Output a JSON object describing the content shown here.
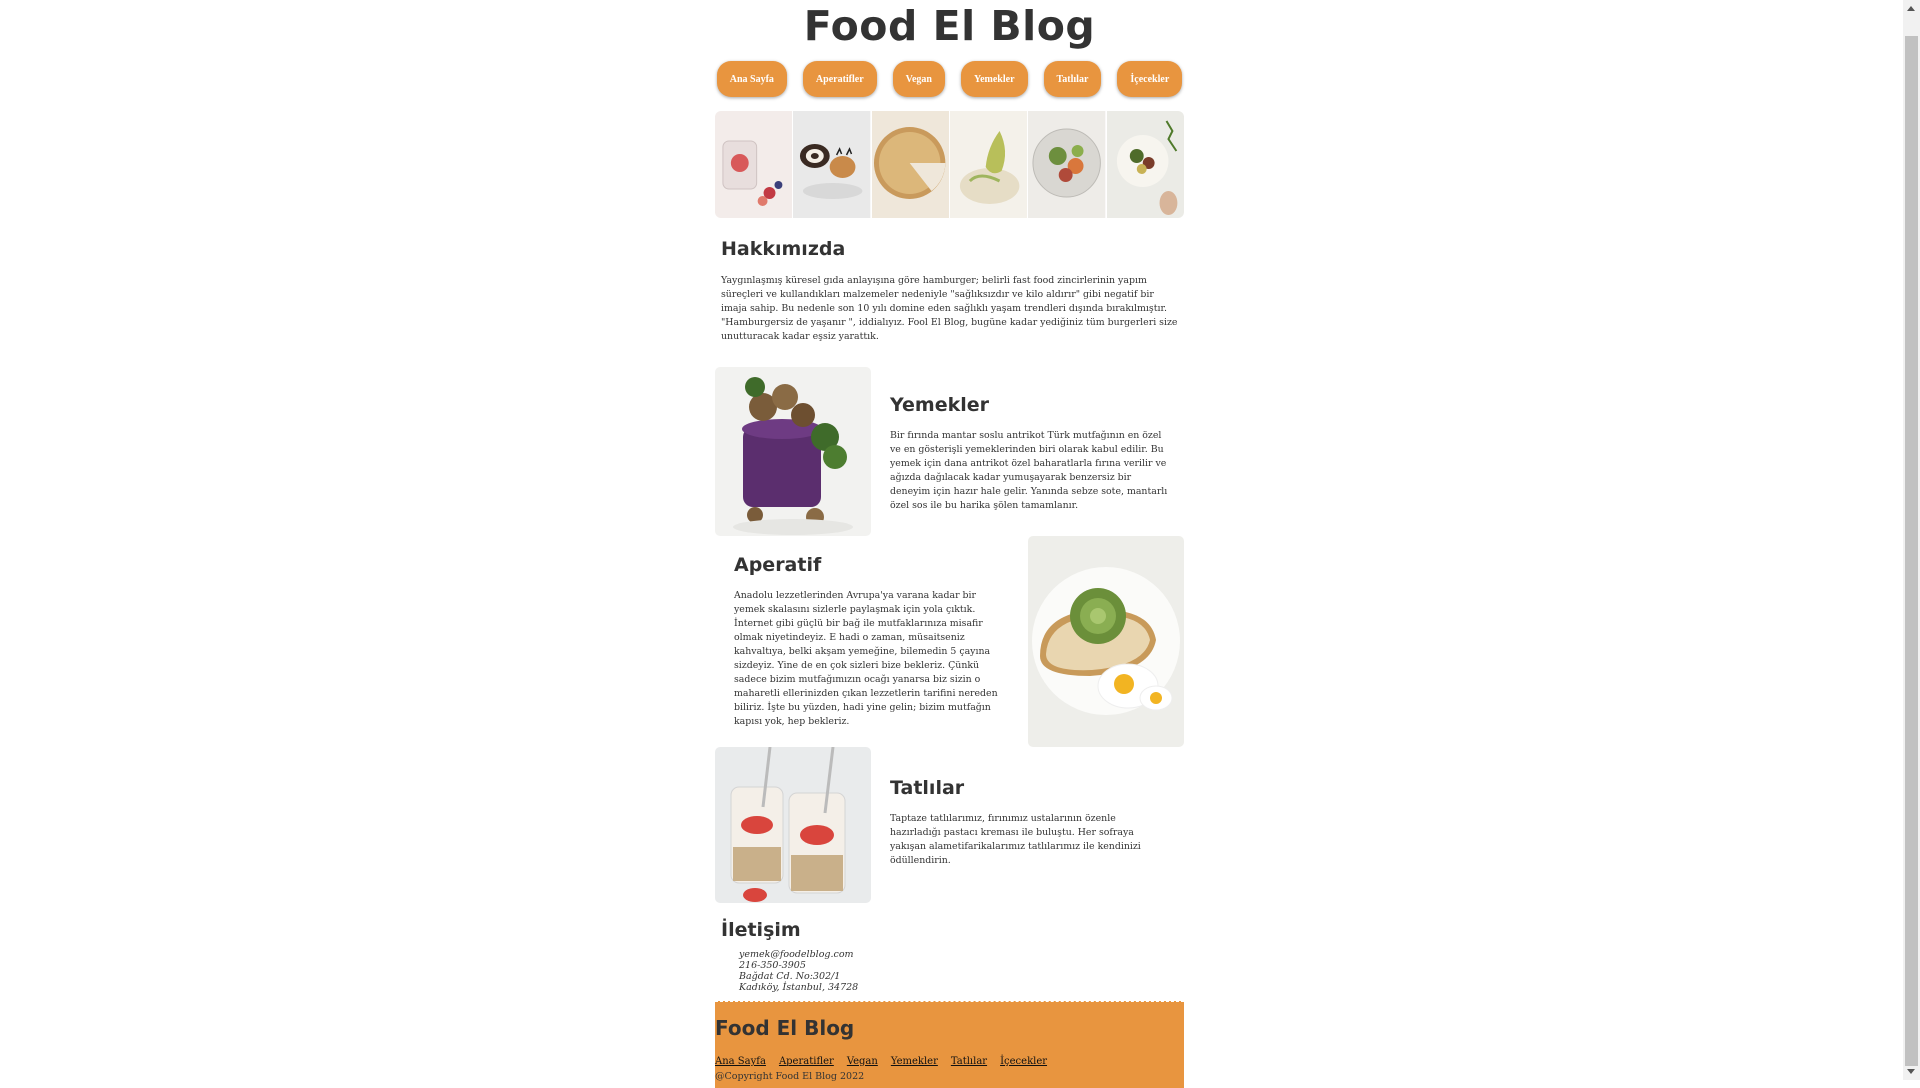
{
  "site_title": "Food El Blog",
  "nav": [
    "Ana Sayfa",
    "Aperatifler",
    "Vegan",
    "Yemekler",
    "Tatlılar",
    "İçecekler"
  ],
  "gallery_icons": [
    "fruit-jar-photo",
    "cake-roll-photo",
    "pie-photo",
    "pear-dish-photo",
    "salad-bowl-photo",
    "salad-plate-photo"
  ],
  "about": {
    "heading": "Hakkımızda",
    "text": "Yaygınlaşmış küresel gıda anlayışına göre hamburger; belirli fast food zincirlerinin yapım süreçleri ve kullandıkları malzemeler nedeniyle \"sağlıksızdır ve kilo aldırır\" gibi negatif bir imaja sahip. Bu nedenle son 10 yılı domine eden sağlıklı yaşam trendleri dışında bırakılmıştır. \"Hamburgersiz de yaşanır \", iddialıyız. Fool El Blog, bugüne kadar yediğiniz tüm burgerleri size unutturacak kadar eşsiz yarattık."
  },
  "yemekler": {
    "heading": "Yemekler",
    "text": "Bir fırında mantar soslu antrikot Türk mutfağının en özel ve en gösterişli yemeklerinden biri olarak kabul edilir. Bu yemek için dana antrikot özel baharatlarla fırına verilir ve ağızda dağılacak kadar yumuşayarak benzersiz bir deneyim için hazır hale gelir. Yanında sebze sote, mantarlı özel sos ile bu harika şölen tamamlanır."
  },
  "aperatif": {
    "heading": "Aperatif",
    "text": "Anadolu lezzetlerinden Avrupa'ya varana kadar bir yemek skalasını sizlerle paylaşmak için yola çıktık. İnternet gibi güçlü bir bağ ile mutfaklarınıza misafir olmak niyetindeyiz. E hadi o zaman, müsaitseniz kahvaltıya, belki akşam yemeğine, bilemedin 5 çayına sizdeyiz. Yine de en çok sizleri bize bekleriz. Çünkü sadece bizim mutfağımızın ocağı yanarsa biz sizin o maharetli ellerinizden çıkan lezzetlerin tarifini nereden biliriz. İşte bu yüzden, hadi yine gelin; bizim mutfağın kapısı yok, hep bekleriz."
  },
  "tatlilar": {
    "heading": "Tatlılar",
    "text": "Taptaze tatlılarımız, fırınımız ustalarının özenle hazırladığı pastacı kreması ile buluştu. Her sofraya yakışan alametifarikalarımız tatlılarımız ile kendinizi ödüllendirin."
  },
  "contact": {
    "heading": "İletişim",
    "email": "yemek@foodelblog.com",
    "phone": "216-350-3905",
    "address1": "Bağdat Cd. No:302/1",
    "address2": "Kadıköy, İstanbul, 34728"
  },
  "footer": {
    "title": "Food El Blog",
    "links": [
      "Ana Sayfa",
      "Aperatifler",
      "Vegan",
      "Yemekler",
      "Tatlılar",
      "İçecekler"
    ],
    "copyright": "@Copyright Food El Blog 2022"
  },
  "colors": {
    "accent": "#e8953f",
    "text": "#333333"
  }
}
